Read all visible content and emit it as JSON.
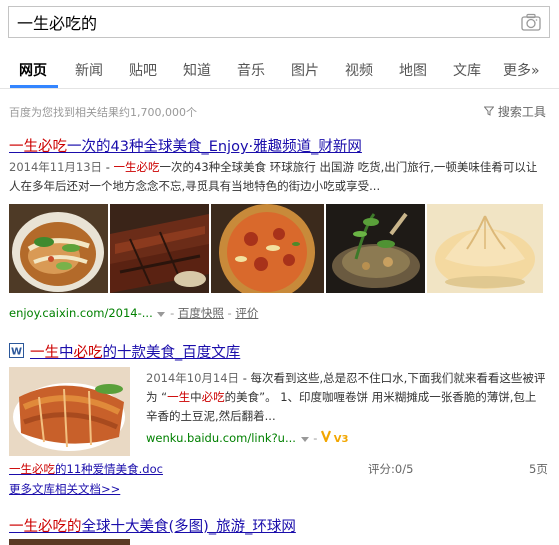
{
  "search": {
    "query": "一生必吃的"
  },
  "tabs": [
    {
      "label": "网页"
    },
    {
      "label": "新闻"
    },
    {
      "label": "贴吧"
    },
    {
      "label": "知道"
    },
    {
      "label": "音乐"
    },
    {
      "label": "图片"
    },
    {
      "label": "视频"
    },
    {
      "label": "地图"
    },
    {
      "label": "文库"
    },
    {
      "label": "更多»"
    }
  ],
  "results_meta": {
    "count_text": "百度为您找到相关结果约1,700,000个",
    "tools_label": "搜索工具"
  },
  "result1": {
    "title_hl": "一生必吃",
    "title_rest": "一次的43种全球美食_Enjoy·雅趣频道_财新网",
    "date": "2014年11月13日",
    "snippet_sep": " - ",
    "snippet_hl": "一生必吃",
    "snippet_rest": "一次的43种全球美食 环球旅行 出国游 吃货,出门旅行,一顿美味佳肴可以让人在多年后还对一个地方念念不忘,寻觅具有当地特色的街边小吃或享受...",
    "url": "enjoy.caixin.com/2014-...",
    "cache_label": "百度快照",
    "sep": "-",
    "review_label": "评价"
  },
  "result2": {
    "title_hl1": "一生",
    "title_mid": "中",
    "title_hl2": "必吃",
    "title_rest": "的十款美食_百度文库",
    "date": "2014年10月14日",
    "snippet_a": " - 每次看到这些,总是忍不住口水,下面我们就来看看这些被评为 “",
    "snippet_hl1": "一生",
    "snippet_b": "中",
    "snippet_hl2": "必吃",
    "snippet_c": "的美食”。 1、印度咖喱卷饼 用米糊摊成一张香脆的薄饼,包上辛香的土豆泥,然后翻着...",
    "url": "wenku.baidu.com/link?u...",
    "v_badge": "V3",
    "doc_title_hl": "一生必吃",
    "doc_title_rest": "的11种爱情美食.doc",
    "rating": "评分:0/5",
    "pages": "5页",
    "more_docs": "更多文库相关文档>>"
  },
  "result3": {
    "title_hl1": "一生必吃的",
    "title_rest": "全球十大美食(多图)_旅游_环球网"
  },
  "colors": {
    "link": "#1a0dab",
    "highlight": "#c00000",
    "url": "#008000",
    "accent": "#3385ff"
  }
}
